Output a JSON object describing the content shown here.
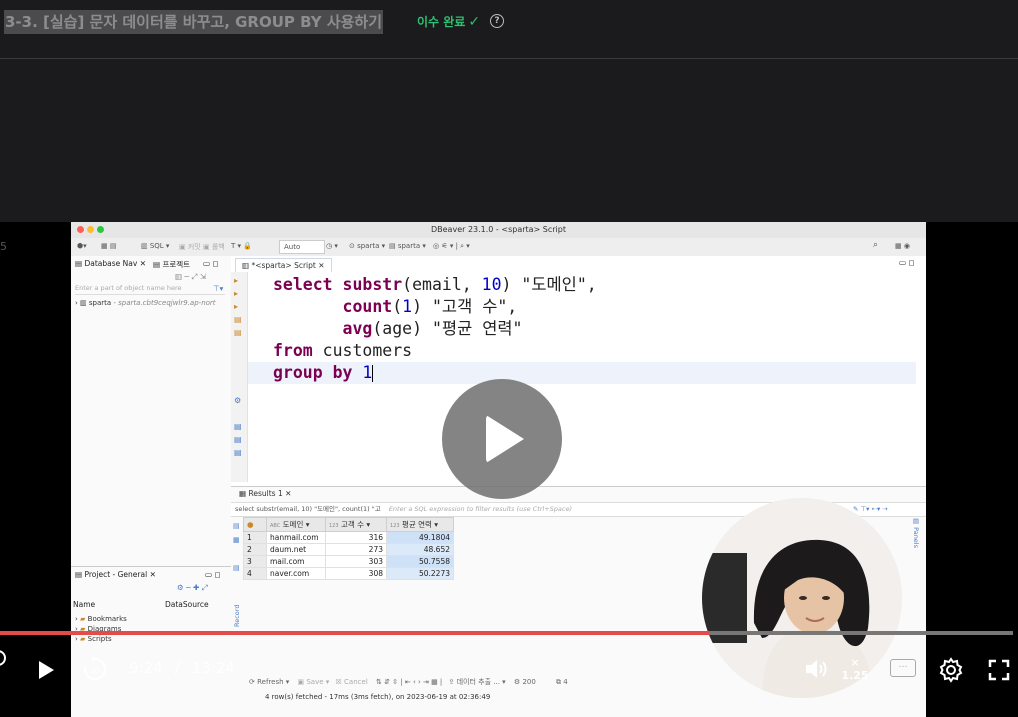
{
  "header": {
    "lesson_title": "3-3. [실습] 문자 데이터를 바꾸고, GROUP BY 사용하기",
    "completed_label": "이수 완료",
    "check_symbol": "✓",
    "help_symbol": "?"
  },
  "video": {
    "side_number": "5",
    "current_time": "9:24",
    "separator": "/",
    "duration": "13:24",
    "speed_x": "×",
    "speed_value": "1.25",
    "progress_fraction": 0.7,
    "colors": {
      "progress_fill": "#e64b4b",
      "progress_track": "#777777",
      "completed_text": "#2fbf71"
    }
  },
  "dbeaver": {
    "window_title": "DBeaver 23.1.0 - <sparta> Script",
    "toolbar": {
      "sql_label": "SQL",
      "commit_label": "커밋",
      "rollback_label": "롤백",
      "mode_value": "Auto",
      "datasource_label": "sparta",
      "schema_label": "sparta"
    },
    "nav": {
      "tab_database": "Database Nav",
      "tab_project": "프로젝트",
      "filter_placeholder": "Enter a part of object name here",
      "connection_name": "sparta",
      "connection_host": "- sparta.cbt9ceqjwlr9.ap-nort"
    },
    "project": {
      "tab_label": "Project - General",
      "col_name": "Name",
      "col_datasource": "DataSource",
      "items": [
        "Bookmarks",
        "Diagrams",
        "Scripts"
      ]
    },
    "editor": {
      "tab_label": "*<sparta> Script",
      "line1_kw": "select",
      "line1_func": "substr",
      "line1_args": "(email, ",
      "line1_num": "10",
      "line1_rest": ") \"도메인\",",
      "line2_func": "count",
      "line2_open": "(",
      "line2_num": "1",
      "line2_rest": ") \"고객 수\",",
      "line3_func": "avg",
      "line3_rest": "(age) \"평균 연력\"",
      "line4_kw": "from",
      "line4_rest": " customers",
      "line5_kw": "group by",
      "line5_num": "1"
    },
    "results": {
      "tab_label": "Results 1",
      "query_preview": "select substr(email, 10) \"도메인\", count(1) \"고",
      "filter_placeholder": "Enter a SQL expression to filter results (use Ctrl+Space)",
      "columns": [
        "도메인",
        "고객 수",
        "평균 연력"
      ],
      "rows": [
        {
          "n": "1",
          "domain": "hanmail.com",
          "count": "316",
          "avg": "49.1804"
        },
        {
          "n": "2",
          "domain": "daum.net",
          "count": "273",
          "avg": "48.652"
        },
        {
          "n": "3",
          "domain": "mail.com",
          "count": "303",
          "avg": "50.7558"
        },
        {
          "n": "4",
          "domain": "naver.com",
          "count": "308",
          "avg": "50.2273"
        }
      ],
      "refresh_label": "Refresh",
      "save_label": "Save",
      "cancel_label": "Cancel",
      "export_label": "데이터 추출 ...",
      "fetch_size": "200",
      "row_count": "4",
      "status_text": "4 row(s) fetched - 17ms (3ms fetch), on 2023-06-19 at 02:36:49",
      "side_panel_label": "Panels",
      "record_label": "Record"
    }
  }
}
